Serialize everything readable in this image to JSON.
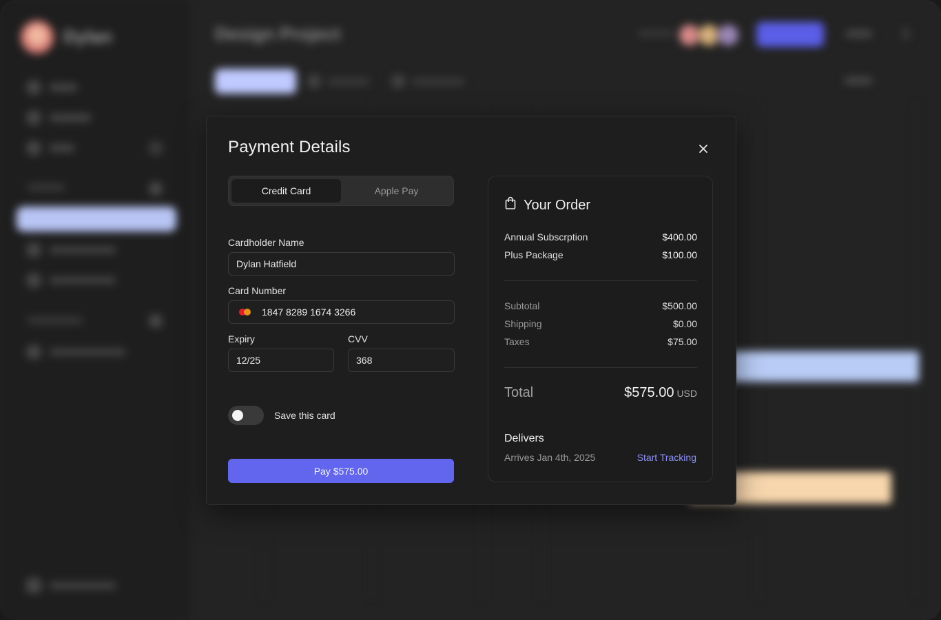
{
  "background": {
    "user_name": "Dylan",
    "page_title": "Design Project"
  },
  "modal": {
    "title": "Payment Details",
    "close_icon": "close-icon",
    "tabs": [
      {
        "label": "Credit Card",
        "active": true
      },
      {
        "label": "Apple Pay",
        "active": false
      }
    ],
    "form": {
      "cardholder_label": "Cardholder Name",
      "cardholder_value": "Dylan Hatfield",
      "card_number_label": "Card Number",
      "card_number_value": "1847 8289 1674 3266",
      "expiry_label": "Expiry",
      "expiry_value": "12/25",
      "cvv_label": "CVV",
      "cvv_value": "368",
      "save_card_label": "Save this card",
      "save_card_on": false,
      "pay_button": "Pay $575.00"
    },
    "order": {
      "title": "Your Order",
      "icon": "shopping-bag-icon",
      "items": [
        {
          "name": "Annual Subscrption",
          "price": "$400.00"
        },
        {
          "name": "Plus Package",
          "price": "$100.00"
        }
      ],
      "summary": [
        {
          "name": "Subtotal",
          "value": "$500.00"
        },
        {
          "name": "Shipping",
          "value": "$0.00"
        },
        {
          "name": "Taxes",
          "value": "$75.00"
        }
      ],
      "total_label": "Total",
      "total_amount": "$575.00",
      "total_currency": "USD",
      "delivers_title": "Delivers",
      "arrives_text": "Arrives Jan 4th, 2025",
      "tracking_link": "Start Tracking"
    }
  },
  "colors": {
    "accent": "#6266ef",
    "link": "#8b8ff5"
  }
}
